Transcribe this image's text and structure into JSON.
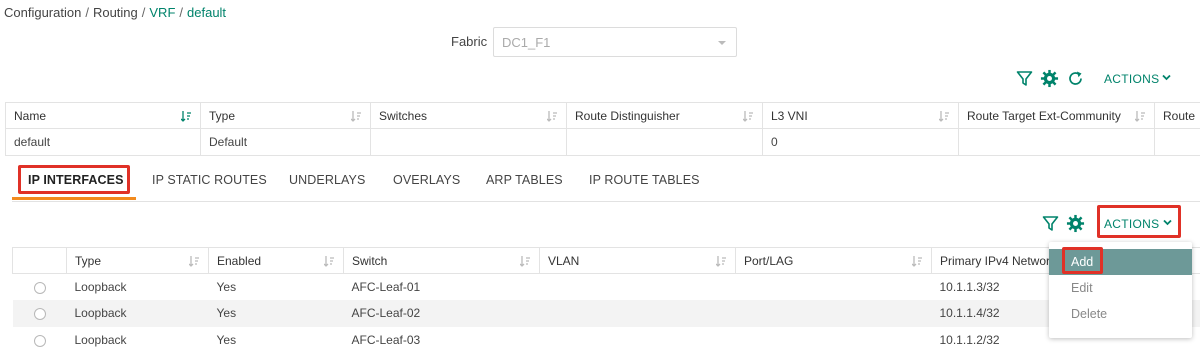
{
  "breadcrumb": {
    "items": [
      "Configuration",
      "Routing",
      "VRF",
      "default"
    ],
    "separator": "/"
  },
  "fabric": {
    "label": "Fabric",
    "value": "DC1_F1"
  },
  "top_toolbar": {
    "actions_label": "ACTIONS"
  },
  "vrf_table": {
    "headers": [
      "Name",
      "Type",
      "Switches",
      "Route Distinguisher",
      "L3 VNI",
      "Route Target Ext-Community",
      "Route"
    ],
    "rows": [
      {
        "name": "default",
        "type": "Default",
        "switches": "",
        "route_distinguisher": "",
        "l3_vni": "0",
        "route_target": "",
        "route": ""
      }
    ]
  },
  "tabs": [
    "IP INTERFACES",
    "IP STATIC ROUTES",
    "UNDERLAYS",
    "OVERLAYS",
    "ARP TABLES",
    "IP ROUTE TABLES"
  ],
  "bottom_toolbar": {
    "actions_label": "ACTIONS"
  },
  "interfaces_table": {
    "headers": [
      "",
      "Type",
      "Enabled",
      "Switch",
      "VLAN",
      "Port/LAG",
      "Primary IPv4 Network"
    ],
    "rows": [
      {
        "type": "Loopback",
        "enabled": "Yes",
        "switch": "AFC-Leaf-01",
        "vlan": "",
        "port": "",
        "ipv4": "10.1.1.3/32"
      },
      {
        "type": "Loopback",
        "enabled": "Yes",
        "switch": "AFC-Leaf-02",
        "vlan": "",
        "port": "",
        "ipv4": "10.1.1.4/32"
      },
      {
        "type": "Loopback",
        "enabled": "Yes",
        "switch": "AFC-Leaf-03",
        "vlan": "",
        "port": "",
        "ipv4": "10.1.1.2/32"
      }
    ]
  },
  "actions_menu": {
    "items": [
      "Add",
      "Edit",
      "Delete"
    ]
  },
  "colors": {
    "accent": "#00836b",
    "tab_underline": "#f28a1e",
    "highlight": "#e03127",
    "menu_hover": "#6d9998"
  },
  "icons": [
    "filter-icon",
    "settings-gear-icon",
    "refresh-icon",
    "chevron-down-icon",
    "sort-icon",
    "radio-button"
  ]
}
